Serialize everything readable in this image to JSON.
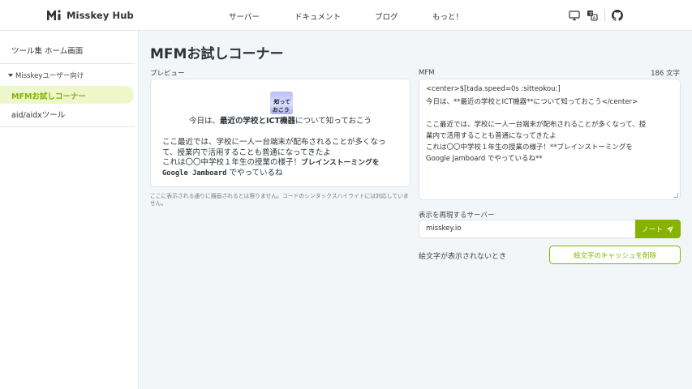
{
  "header": {
    "logo_text": "Misskey Hub",
    "nav": [
      "サーバー",
      "ドキュメント",
      "ブログ",
      "もっと！"
    ],
    "icons": [
      "monitor-icon",
      "translate-icon",
      "github-icon"
    ],
    "accent": "#86b300"
  },
  "sidebar": {
    "home": "ツール集 ホーム画面",
    "group": "Misskeyユーザー向け",
    "active_item": "MFMお試しコーナー",
    "items": [
      "aid/aidxツール"
    ]
  },
  "main": {
    "title": "MFMお試しコーナー",
    "preview_label": "プレビュー",
    "emoji_text": "知っておこう",
    "preview": {
      "center_pre": "今日は、",
      "center_bold": "最近の学校とICT機器",
      "center_post": "について知っておこう",
      "line1": "ここ最近では、学校に一人一台端末が配布されることが多くなっ",
      "line2": "て、授業内で活用することも普通になってきたよ",
      "line3_pre": "これは〇〇中学校１年生の授業の様子！",
      "line3_bold": "ブレインストーミングを",
      "line4_bold": "Google Jamboard",
      "line4_post": " でやっているね"
    },
    "note": "ここに表示される通りに描画されるとは限りません。コードのシンタックスハイライトには対応していません。",
    "mfm_label": "MFM",
    "char_count": "186 文字",
    "mfm_lines": [
      "<center>$[tada.speed=0s :sitteokou:]",
      "今日は、**最近の学校とICT機器**について知っておこう</center>",
      "ここ最近では、学校に一人一台端末が配布されることが多くなって、授",
      "業内で活用することも普通になってきたよ",
      "これは〇〇中学校１年生の授業の様子！**ブレインストーミングを",
      "Google Jamboard でやっているね**"
    ],
    "server_label": "表示を再現するサーバー",
    "server_value": "misskey.io",
    "note_button": "ノート",
    "emoji_question": "絵文字が表示されないとき",
    "cache_button": "絵文字のキャッシュを削除"
  }
}
